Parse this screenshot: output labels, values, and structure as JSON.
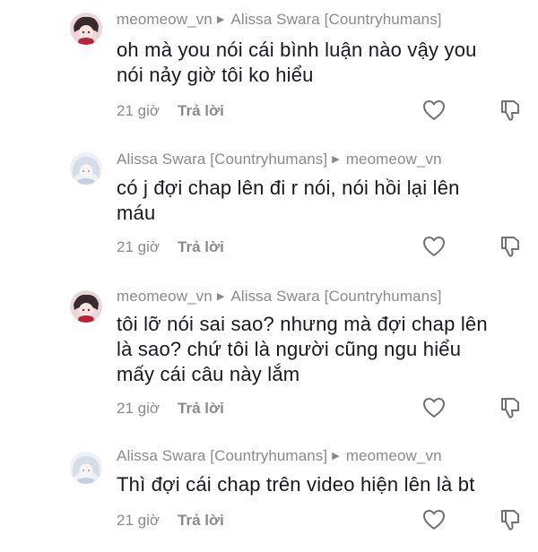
{
  "comments": [
    {
      "author": "meomeow_vn",
      "reply_to": "Alissa Swara [Countryhumans]",
      "text_lines": [
        "oh mà you nói cái bình luận nào vậy you",
        "nói nảy giờ tôi ko hiểu"
      ],
      "time": "21 giờ",
      "reply_label": "Trả lời",
      "avatar": "dark-avatar"
    },
    {
      "author": "Alissa Swara [Countryhumans]",
      "reply_to": "meomeow_vn",
      "text_lines": [
        "có j đợi chap lên đi r nói, nói hồi lại lên",
        "máu"
      ],
      "time": "21 giờ",
      "reply_label": "Trả lời",
      "avatar": "light-avatar"
    },
    {
      "author": "meomeow_vn",
      "reply_to": "Alissa Swara [Countryhumans]",
      "text_lines": [
        "tôi lỡ nói sai sao? nhưng mà đợi chap lên",
        "là sao? chứ tôi là người cũng ngu hiểu",
        "mấy cái câu này lắm"
      ],
      "time": "21 giờ",
      "reply_label": "Trả lời",
      "avatar": "dark-avatar"
    },
    {
      "author": "Alissa Swara [Countryhumans]",
      "reply_to": "meomeow_vn",
      "text_lines": [
        "Thì đợi cái chap trên video hiện lên là bt"
      ],
      "time": "21 giờ",
      "reply_label": "Trả lời",
      "avatar": "light-avatar"
    }
  ],
  "colors": {
    "text": "#161823",
    "muted": "#8a8a8e"
  }
}
